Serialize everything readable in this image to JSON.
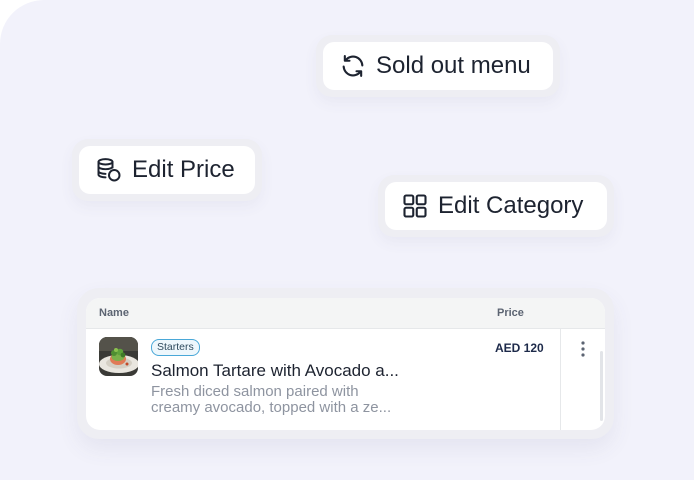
{
  "actions": {
    "sold_out_label": "Sold out menu",
    "edit_price_label": "Edit Price",
    "edit_category_label": "Edit Category"
  },
  "icons": {
    "sold_out": "refresh-icon",
    "edit_price": "coins-icon",
    "edit_category": "grid-icon",
    "row_menu": "kebab-menu-icon"
  },
  "table": {
    "columns": [
      "Name",
      "Price"
    ],
    "rows": [
      {
        "category": "Starters",
        "title": "Salmon Tartare with Avocado a...",
        "description_line1": "Fresh diced salmon paired with",
        "description_line2": "creamy avocado, topped with a ze...",
        "price": "AED 120"
      }
    ]
  },
  "colors": {
    "background": "#f2f2fb",
    "text_primary": "#1d2330",
    "badge_border": "#4aa8d8",
    "price_text": "#1d2a4a"
  }
}
